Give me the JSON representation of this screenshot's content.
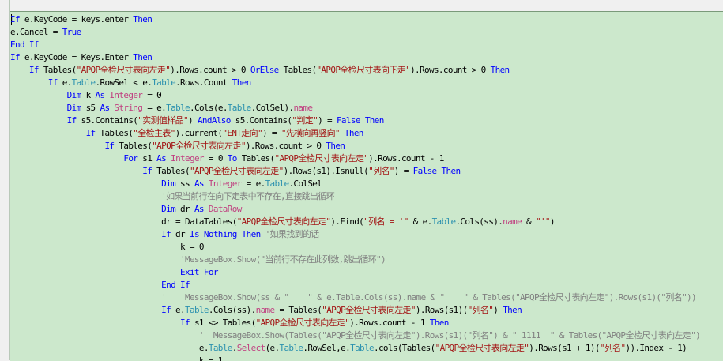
{
  "lines": [
    [
      {
        "t": "If",
        "c": "k"
      },
      {
        "t": " e.KeyCode = keys.enter "
      },
      {
        "t": "Then",
        "c": "k"
      }
    ],
    [
      {
        "t": "e.Cancel = "
      },
      {
        "t": "True",
        "c": "k"
      }
    ],
    [
      {
        "t": "End If",
        "c": "k"
      }
    ],
    [
      {
        "t": "If",
        "c": "k"
      },
      {
        "t": " e.KeyCode = Keys.Enter "
      },
      {
        "t": "Then",
        "c": "k"
      }
    ],
    [
      {
        "t": "    "
      },
      {
        "t": "If",
        "c": "k"
      },
      {
        "t": " Tables("
      },
      {
        "t": "\"APQP全检尺寸表向左走\"",
        "c": "s"
      },
      {
        "t": ").Rows.count > 0 "
      },
      {
        "t": "OrElse",
        "c": "k"
      },
      {
        "t": " Tables("
      },
      {
        "t": "\"APQP全检尺寸表向下走\"",
        "c": "s"
      },
      {
        "t": ").Rows.count > 0 "
      },
      {
        "t": "Then",
        "c": "k"
      }
    ],
    [
      {
        "t": "        "
      },
      {
        "t": "If",
        "c": "k"
      },
      {
        "t": " e."
      },
      {
        "t": "Table",
        "c": "t"
      },
      {
        "t": ".RowSel < e."
      },
      {
        "t": "Table",
        "c": "t"
      },
      {
        "t": ".Rows.Count "
      },
      {
        "t": "Then",
        "c": "k"
      }
    ],
    [
      {
        "t": "            "
      },
      {
        "t": "Dim",
        "c": "k"
      },
      {
        "t": " k "
      },
      {
        "t": "As",
        "c": "k"
      },
      {
        "t": " "
      },
      {
        "t": "Integer",
        "c": "p"
      },
      {
        "t": " = 0"
      }
    ],
    [
      {
        "t": "            "
      },
      {
        "t": "Dim",
        "c": "k"
      },
      {
        "t": " s5 "
      },
      {
        "t": "As",
        "c": "k"
      },
      {
        "t": " "
      },
      {
        "t": "String",
        "c": "p"
      },
      {
        "t": " = e."
      },
      {
        "t": "Table",
        "c": "t"
      },
      {
        "t": ".Cols(e."
      },
      {
        "t": "Table",
        "c": "t"
      },
      {
        "t": ".ColSel)."
      },
      {
        "t": "name",
        "c": "p"
      }
    ],
    [
      {
        "t": "            "
      },
      {
        "t": "If",
        "c": "k"
      },
      {
        "t": " s5.Contains("
      },
      {
        "t": "\"实测值样品\"",
        "c": "s"
      },
      {
        "t": ") "
      },
      {
        "t": "AndAlso",
        "c": "k"
      },
      {
        "t": " s5.Contains("
      },
      {
        "t": "\"判定\"",
        "c": "s"
      },
      {
        "t": ") = "
      },
      {
        "t": "False",
        "c": "k"
      },
      {
        "t": " "
      },
      {
        "t": "Then",
        "c": "k"
      }
    ],
    [
      {
        "t": "                "
      },
      {
        "t": "If",
        "c": "k"
      },
      {
        "t": " Tables("
      },
      {
        "t": "\"全检主表\"",
        "c": "s"
      },
      {
        "t": ").current("
      },
      {
        "t": "\"ENT走向\"",
        "c": "s"
      },
      {
        "t": ") = "
      },
      {
        "t": "\"先横向再竖向\"",
        "c": "s"
      },
      {
        "t": " "
      },
      {
        "t": "Then",
        "c": "k"
      }
    ],
    [
      {
        "t": "                    "
      },
      {
        "t": "If",
        "c": "k"
      },
      {
        "t": " Tables("
      },
      {
        "t": "\"APQP全检尺寸表向左走\"",
        "c": "s"
      },
      {
        "t": ").Rows.count > 0 "
      },
      {
        "t": "Then",
        "c": "k"
      }
    ],
    [
      {
        "t": "                        "
      },
      {
        "t": "For",
        "c": "k"
      },
      {
        "t": " s1 "
      },
      {
        "t": "As",
        "c": "k"
      },
      {
        "t": " "
      },
      {
        "t": "Integer",
        "c": "p"
      },
      {
        "t": " = 0 "
      },
      {
        "t": "To",
        "c": "k"
      },
      {
        "t": " Tables("
      },
      {
        "t": "\"APQP全检尺寸表向左走\"",
        "c": "s"
      },
      {
        "t": ").Rows.count - 1"
      }
    ],
    [
      {
        "t": "                            "
      },
      {
        "t": "If",
        "c": "k"
      },
      {
        "t": " Tables("
      },
      {
        "t": "\"APQP全检尺寸表向左走\"",
        "c": "s"
      },
      {
        "t": ").Rows(s1).Isnull("
      },
      {
        "t": "\"列名\"",
        "c": "s"
      },
      {
        "t": ") = "
      },
      {
        "t": "False",
        "c": "k"
      },
      {
        "t": " "
      },
      {
        "t": "Then",
        "c": "k"
      }
    ],
    [
      {
        "t": "                                "
      },
      {
        "t": "Dim",
        "c": "k"
      },
      {
        "t": " ss "
      },
      {
        "t": "As",
        "c": "k"
      },
      {
        "t": " "
      },
      {
        "t": "Integer",
        "c": "p"
      },
      {
        "t": " = e."
      },
      {
        "t": "Table",
        "c": "t"
      },
      {
        "t": ".ColSel"
      }
    ],
    [
      {
        "t": "                                "
      },
      {
        "t": "'如果当前行在向下走表中不存在,直接跳出循环",
        "c": "c"
      }
    ],
    [
      {
        "t": "                                "
      },
      {
        "t": "Dim",
        "c": "k"
      },
      {
        "t": " dr "
      },
      {
        "t": "As",
        "c": "k"
      },
      {
        "t": " "
      },
      {
        "t": "DataRow",
        "c": "p"
      }
    ],
    [
      {
        "t": "                                dr = DataTables("
      },
      {
        "t": "\"APQP全检尺寸表向左走\"",
        "c": "s"
      },
      {
        "t": ").Find("
      },
      {
        "t": "\"列名 = '\"",
        "c": "s"
      },
      {
        "t": " & e."
      },
      {
        "t": "Table",
        "c": "t"
      },
      {
        "t": ".Cols(ss)."
      },
      {
        "t": "name",
        "c": "p"
      },
      {
        "t": " & "
      },
      {
        "t": "\"'\"",
        "c": "s"
      },
      {
        "t": ")"
      }
    ],
    [
      {
        "t": "                                "
      },
      {
        "t": "If",
        "c": "k"
      },
      {
        "t": " dr "
      },
      {
        "t": "Is Nothing",
        "c": "k"
      },
      {
        "t": " "
      },
      {
        "t": "Then",
        "c": "k"
      },
      {
        "t": " "
      },
      {
        "t": "'如果找到的话",
        "c": "c"
      }
    ],
    [
      {
        "t": "                                    k = 0"
      }
    ],
    [
      {
        "t": "                                    "
      },
      {
        "t": "'MessageBox.Show(\"当前行不存在此列数,跳出循环\")",
        "c": "c"
      }
    ],
    [
      {
        "t": "                                    "
      },
      {
        "t": "Exit For",
        "c": "k"
      }
    ],
    [
      {
        "t": "                                "
      },
      {
        "t": "End If",
        "c": "k"
      }
    ],
    [
      {
        "t": "                                "
      },
      {
        "t": "'    MessageBox.Show(ss & \"    \" & e.Table.Cols(ss).name & \"    \" & Tables(\"APQP全检尺寸表向左走\").Rows(s1)(\"列名\"))",
        "c": "c"
      }
    ],
    [
      {
        "t": "                                "
      },
      {
        "t": "If",
        "c": "k"
      },
      {
        "t": " e."
      },
      {
        "t": "Table",
        "c": "t"
      },
      {
        "t": ".Cols(ss)."
      },
      {
        "t": "name",
        "c": "p"
      },
      {
        "t": " = Tables("
      },
      {
        "t": "\"APQP全检尺寸表向左走\"",
        "c": "s"
      },
      {
        "t": ").Rows(s1)("
      },
      {
        "t": "\"列名\"",
        "c": "s"
      },
      {
        "t": ") "
      },
      {
        "t": "Then",
        "c": "k"
      }
    ],
    [
      {
        "t": "                                    "
      },
      {
        "t": "If",
        "c": "k"
      },
      {
        "t": " s1 <> Tables("
      },
      {
        "t": "\"APQP全检尺寸表向左走\"",
        "c": "s"
      },
      {
        "t": ").Rows.count - 1 "
      },
      {
        "t": "Then",
        "c": "k"
      }
    ],
    [
      {
        "t": "                                        "
      },
      {
        "t": "'  MessageBox.Show(Tables(\"APQP全检尺寸表向左走\").Rows(s1)(\"列名\") & \" 1111  \" & Tables(\"APQP全检尺寸表向左走\")",
        "c": "c"
      }
    ],
    [
      {
        "t": "                                        e."
      },
      {
        "t": "Table",
        "c": "t"
      },
      {
        "t": "."
      },
      {
        "t": "Select",
        "c": "p"
      },
      {
        "t": "(e."
      },
      {
        "t": "Table",
        "c": "t"
      },
      {
        "t": ".RowSel,e."
      },
      {
        "t": "Table",
        "c": "t"
      },
      {
        "t": ".cols(Tables("
      },
      {
        "t": "\"APQP全检尺寸表向左走\"",
        "c": "s"
      },
      {
        "t": ").Rows(s1 + 1)("
      },
      {
        "t": "\"列名\"",
        "c": "s"
      },
      {
        "t": ")).Index - 1)"
      }
    ],
    [
      {
        "t": "                                        k = 1"
      }
    ]
  ]
}
